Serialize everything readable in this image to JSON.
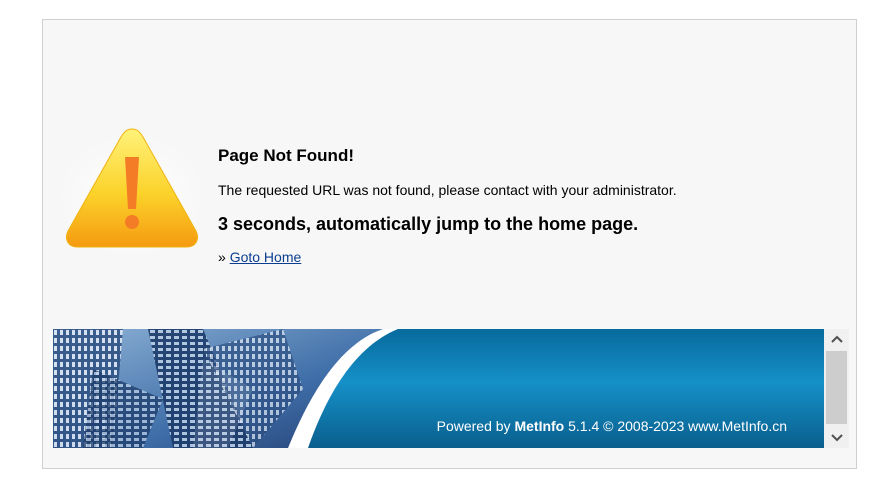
{
  "error": {
    "title": "Page Not Found!",
    "message": "The requested URL was not found, please contact with your administrator.",
    "redirect": "3 seconds, automatically jump to the home page.",
    "nav_prefix": "»",
    "home_link": "Goto Home"
  },
  "footer": {
    "powered_prefix": "Powered by",
    "brand": "MetInfo",
    "version_copyright": "5.1.4 © 2008-2023 www.MetInfo.cn"
  },
  "icons": {
    "warning": "warning-triangle-icon",
    "scroll_up": "chevron-up-icon",
    "scroll_down": "chevron-down-icon"
  },
  "colors": {
    "warning_yellow": "#f7c400",
    "footer_blue": "#0e78a8",
    "link": "#0b3d91"
  }
}
